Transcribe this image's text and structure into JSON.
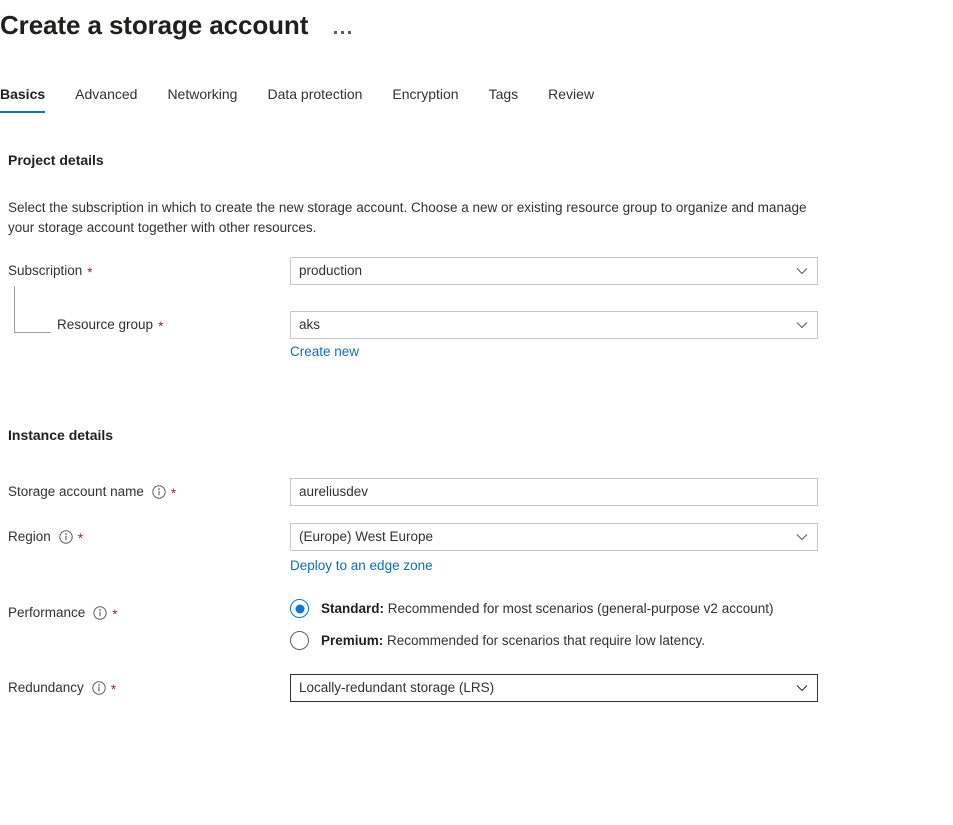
{
  "header": {
    "title": "Create a storage account",
    "more_menu": "…"
  },
  "tabs": [
    {
      "label": "Basics",
      "active": true
    },
    {
      "label": "Advanced",
      "active": false
    },
    {
      "label": "Networking",
      "active": false
    },
    {
      "label": "Data protection",
      "active": false
    },
    {
      "label": "Encryption",
      "active": false
    },
    {
      "label": "Tags",
      "active": false
    },
    {
      "label": "Review",
      "active": false
    }
  ],
  "project_details": {
    "heading": "Project details",
    "description": "Select the subscription in which to create the new storage account. Choose a new or existing resource group to organize and manage your storage account together with other resources.",
    "subscription": {
      "label": "Subscription",
      "required": "*",
      "value": "production"
    },
    "resource_group": {
      "label": "Resource group",
      "required": "*",
      "value": "aks",
      "create_new_link": "Create new"
    }
  },
  "instance_details": {
    "heading": "Instance details",
    "storage_account_name": {
      "label": "Storage account name",
      "required": "*",
      "value": "aureliusdev"
    },
    "region": {
      "label": "Region",
      "required": "*",
      "value": "(Europe) West Europe",
      "edge_zone_link": "Deploy to an edge zone"
    },
    "performance": {
      "label": "Performance",
      "required": "*",
      "options": [
        {
          "name": "Standard:",
          "description": "Recommended for most scenarios (general-purpose v2 account)",
          "selected": true
        },
        {
          "name": "Premium:",
          "description": "Recommended for scenarios that require low latency.",
          "selected": false
        }
      ]
    },
    "redundancy": {
      "label": "Redundancy",
      "required": "*",
      "value": "Locally-redundant storage (LRS)"
    }
  },
  "icons": {
    "info": "info-icon",
    "chevron_down": "chevron-down-icon",
    "ellipsis": "ellipsis-icon"
  },
  "colors": {
    "accent": "#0078d4",
    "link": "#0f6cbd",
    "required_asterisk": "#a4262c",
    "border": "#c8c6c4",
    "border_focus": "#323130",
    "text": "#323130"
  }
}
